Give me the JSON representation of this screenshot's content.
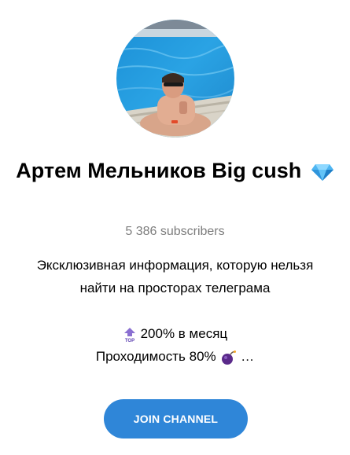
{
  "channel": {
    "name": "Артем Мельников Big cush",
    "verified_icon": "gem-icon",
    "subscribers": "5 386 subscribers"
  },
  "description": {
    "line1": "Эксклюзивная информация, которую нельзя",
    "line2": "найти на просторах телеграма",
    "line3_text": "200% в месяц",
    "line3_icon": "top-arrow-icon",
    "line4_text": "Проходимость 80%",
    "line4_icon": "bomb-icon",
    "line4_suffix": "…"
  },
  "actions": {
    "join_label": "JOIN CHANNEL"
  },
  "colors": {
    "accent": "#2f86d8",
    "muted_text": "#7c7c7c"
  }
}
